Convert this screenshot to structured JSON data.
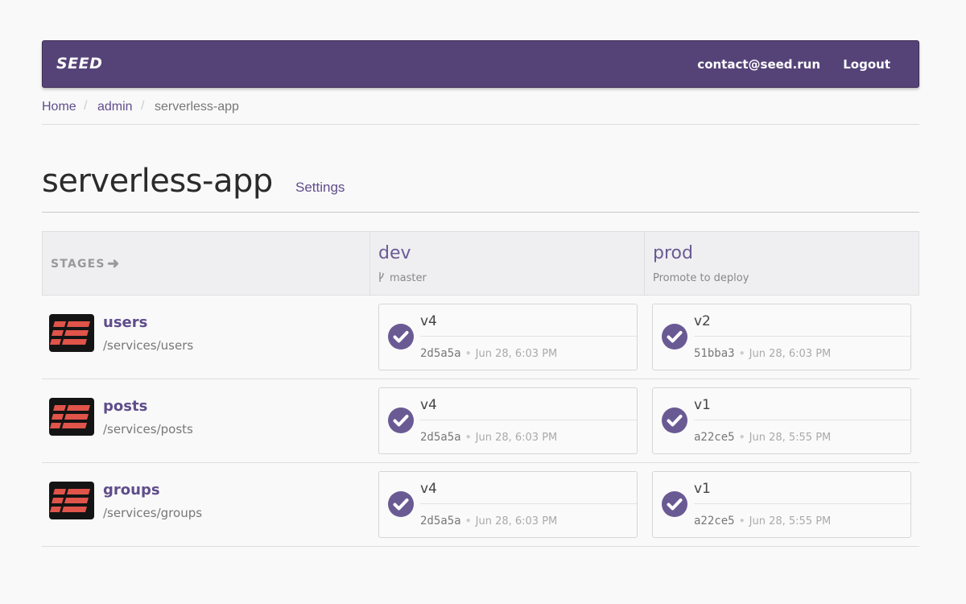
{
  "nav": {
    "brand": "SEED",
    "email": "contact@seed.run",
    "logout": "Logout"
  },
  "breadcrumb": {
    "home": "Home",
    "org": "admin",
    "current": "serverless-app"
  },
  "page": {
    "title": "serverless-app",
    "settings": "Settings"
  },
  "stages_header": "STAGES",
  "stages": [
    {
      "name": "dev",
      "sub": "master",
      "branch_icon": "branch-icon"
    },
    {
      "name": "prod",
      "sub": "Promote to deploy"
    }
  ],
  "services": [
    {
      "name": "users",
      "path": "/services/users",
      "builds": [
        {
          "version": "v4",
          "commit": "2d5a5a",
          "time": "Jun 28, 6:03 PM"
        },
        {
          "version": "v2",
          "commit": "51bba3",
          "time": "Jun 28, 6:03 PM"
        }
      ]
    },
    {
      "name": "posts",
      "path": "/services/posts",
      "builds": [
        {
          "version": "v4",
          "commit": "2d5a5a",
          "time": "Jun 28, 6:03 PM"
        },
        {
          "version": "v1",
          "commit": "a22ce5",
          "time": "Jun 28, 5:55 PM"
        }
      ]
    },
    {
      "name": "groups",
      "path": "/services/groups",
      "builds": [
        {
          "version": "v4",
          "commit": "2d5a5a",
          "time": "Jun 28, 6:03 PM"
        },
        {
          "version": "v1",
          "commit": "a22ce5",
          "time": "Jun 28, 5:55 PM"
        }
      ]
    }
  ],
  "colors": {
    "nav": "#554378",
    "accent": "#6a5a94",
    "icon_red": "#e0544a",
    "icon_bg": "#141414"
  }
}
